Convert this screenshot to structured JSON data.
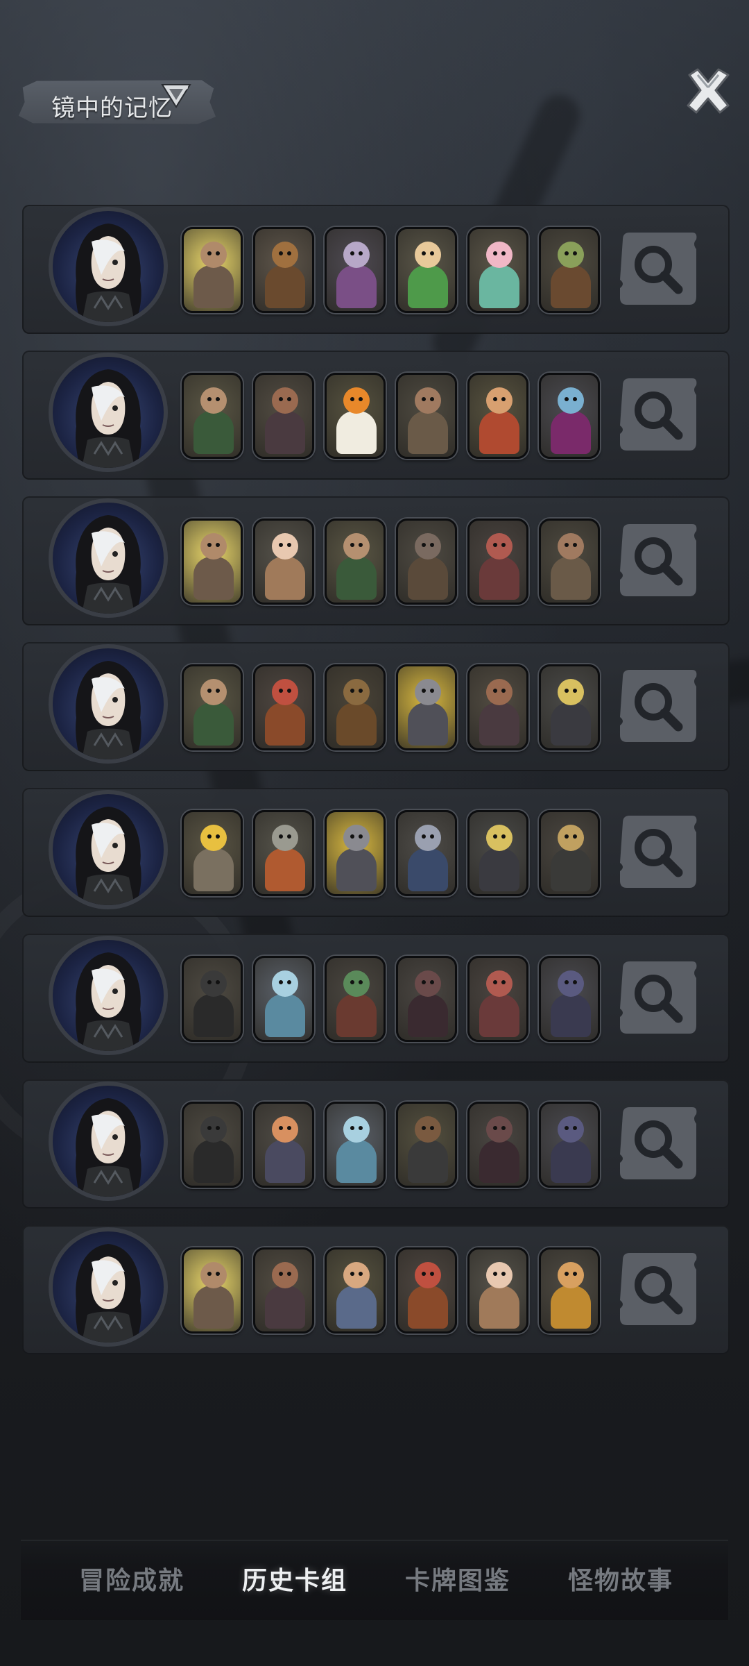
{
  "header": {
    "title": "镜中的记忆",
    "title_icon": "triangle-filter-icon",
    "close_icon": "close-x-icon"
  },
  "deck_rows": [
    {
      "avatar": "hooded-hero-portrait",
      "cards": [
        {
          "name": "armored-knight-card",
          "bg": "#e9d66a",
          "skin": "#b08a6a",
          "cloth": "#6d5a4a"
        },
        {
          "name": "bear-cub-card",
          "bg": "#5e554a",
          "skin": "#a0703f",
          "cloth": "#6a4a2e"
        },
        {
          "name": "mushroom-creature-card",
          "bg": "#4e4a52",
          "skin": "#b7a8c8",
          "cloth": "#7a4f86"
        },
        {
          "name": "leaf-sprite-card",
          "bg": "#5a5648",
          "skin": "#e8c99a",
          "cloth": "#4e9a4a"
        },
        {
          "name": "lotus-fairy-card",
          "bg": "#5a5548",
          "skin": "#f0b7c6",
          "cloth": "#6ab6a0"
        },
        {
          "name": "goblin-witch-card",
          "bg": "#4e4a40",
          "skin": "#8aa05a",
          "cloth": "#6a4a30"
        }
      ],
      "action_icon": "magnifier-icon"
    },
    {
      "avatar": "hooded-hero-portrait",
      "cards": [
        {
          "name": "masked-rogue-card",
          "bg": "#5a5644",
          "skin": "#b59070",
          "cloth": "#3a5a3a"
        },
        {
          "name": "bearded-brute-card",
          "bg": "#524c42",
          "skin": "#9a6a50",
          "cloth": "#4a3a40"
        },
        {
          "name": "pumpkin-head-card",
          "bg": "#56523f",
          "skin": "#e8882a",
          "cloth": "#f0ece0"
        },
        {
          "name": "barbarian-warrior-card",
          "bg": "#4e4a40",
          "skin": "#a07a60",
          "cloth": "#6a5a48"
        },
        {
          "name": "hammer-dwarf-card",
          "bg": "#58533f",
          "skin": "#d8a070",
          "cloth": "#b04a30"
        },
        {
          "name": "dark-elf-card",
          "bg": "#4a4a50",
          "skin": "#7ab0d0",
          "cloth": "#7a2a6a"
        }
      ],
      "action_icon": "magnifier-icon"
    },
    {
      "avatar": "hooded-hero-portrait",
      "cards": [
        {
          "name": "armored-knight-card",
          "bg": "#e9d66a",
          "skin": "#b08a6a",
          "cloth": "#6d5a4a"
        },
        {
          "name": "old-professor-card",
          "bg": "#55524a",
          "skin": "#e8c8b0",
          "cloth": "#a07a5a"
        },
        {
          "name": "masked-rogue-card",
          "bg": "#5a5644",
          "skin": "#b59070",
          "cloth": "#3a5a3a"
        },
        {
          "name": "masked-boar-card",
          "bg": "#4e4a42",
          "skin": "#7a6a60",
          "cloth": "#5a4a3a"
        },
        {
          "name": "red-imp-card",
          "bg": "#4a4440",
          "skin": "#b05a50",
          "cloth": "#6a3a3a"
        },
        {
          "name": "barbarian-warrior-card",
          "bg": "#4e4a40",
          "skin": "#a07a60",
          "cloth": "#6a5a48"
        }
      ],
      "action_icon": "magnifier-icon"
    },
    {
      "avatar": "hooded-hero-portrait",
      "cards": [
        {
          "name": "masked-rogue-card",
          "bg": "#5a5644",
          "skin": "#b59070",
          "cloth": "#3a5a3a"
        },
        {
          "name": "red-ogre-card",
          "bg": "#4e4640",
          "skin": "#c05040",
          "cloth": "#8a4a2a"
        },
        {
          "name": "wooden-golem-card",
          "bg": "#4a4438",
          "skin": "#8a6a40",
          "cloth": "#6a4a2a"
        },
        {
          "name": "lightning-bot-card",
          "bg": "#d8b840",
          "skin": "#8a8a90",
          "cloth": "#505058"
        },
        {
          "name": "bearded-brute-card",
          "bg": "#524c42",
          "skin": "#9a6a50",
          "cloth": "#4a3a40"
        },
        {
          "name": "winged-anubis-card",
          "bg": "#4a4a48",
          "skin": "#d8c060",
          "cloth": "#3a3a40"
        }
      ],
      "action_icon": "magnifier-icon"
    },
    {
      "avatar": "hooded-hero-portrait",
      "cards": [
        {
          "name": "cheese-machine-card",
          "bg": "#5a5544",
          "skin": "#e8c040",
          "cloth": "#7a7060"
        },
        {
          "name": "drill-robot-card",
          "bg": "#55534a",
          "skin": "#9a9a90",
          "cloth": "#b05a30"
        },
        {
          "name": "lightning-bot-card",
          "bg": "#d8b840",
          "skin": "#8a8a90",
          "cloth": "#505058"
        },
        {
          "name": "top-hat-rat-card",
          "bg": "#4e4c48",
          "skin": "#9aa0b0",
          "cloth": "#3a4a6a"
        },
        {
          "name": "winged-anubis-card",
          "bg": "#4a4a48",
          "skin": "#d8c060",
          "cloth": "#3a3a40"
        },
        {
          "name": "puppet-master-card",
          "bg": "#4a4640",
          "skin": "#c0a060",
          "cloth": "#3a3a38"
        }
      ],
      "action_icon": "magnifier-icon"
    },
    {
      "avatar": "hooded-hero-portrait",
      "cards": [
        {
          "name": "shadow-spider-card",
          "bg": "#4e4a42",
          "skin": "#3a3a3a",
          "cloth": "#2a2a2a"
        },
        {
          "name": "frost-fairy-card",
          "bg": "#5a6068",
          "skin": "#a8d0e0",
          "cloth": "#5a8aa0"
        },
        {
          "name": "green-demon-card",
          "bg": "#4a4640",
          "skin": "#5a8a5a",
          "cloth": "#6a3a30"
        },
        {
          "name": "bat-creature-card",
          "bg": "#4a4642",
          "skin": "#6a4a4a",
          "cloth": "#3a2a30"
        },
        {
          "name": "red-imp-card",
          "bg": "#4a4440",
          "skin": "#b05a50",
          "cloth": "#6a3a3a"
        },
        {
          "name": "horned-beast-card",
          "bg": "#4a4a50",
          "skin": "#5a5a80",
          "cloth": "#3a3a50"
        }
      ],
      "action_icon": "magnifier-icon"
    },
    {
      "avatar": "hooded-hero-portrait",
      "cards": [
        {
          "name": "shadow-spider-card",
          "bg": "#4e4a42",
          "skin": "#3a3a3a",
          "cloth": "#2a2a2a"
        },
        {
          "name": "rooster-mage-card",
          "bg": "#4e4a44",
          "skin": "#d89060",
          "cloth": "#4a4a60"
        },
        {
          "name": "frost-fairy-card",
          "bg": "#5a6068",
          "skin": "#a8d0e0",
          "cloth": "#5a8aa0"
        },
        {
          "name": "hedgehog-bandit-card",
          "bg": "#54503f",
          "skin": "#7a5a40",
          "cloth": "#3a3a3a"
        },
        {
          "name": "bat-creature-card",
          "bg": "#4a4642",
          "skin": "#6a4a4a",
          "cloth": "#3a2a30"
        },
        {
          "name": "horned-beast-card",
          "bg": "#4a4a50",
          "skin": "#5a5a80",
          "cloth": "#3a3a50"
        }
      ],
      "action_icon": "magnifier-icon"
    },
    {
      "avatar": "hooded-hero-portrait",
      "cards": [
        {
          "name": "armored-knight-card",
          "bg": "#e9d66a",
          "skin": "#b08a6a",
          "cloth": "#6d5a4a"
        },
        {
          "name": "bearded-brute-card",
          "bg": "#524c42",
          "skin": "#9a6a50",
          "cloth": "#4a3a40"
        },
        {
          "name": "lumberjack-card",
          "bg": "#56523f",
          "skin": "#d8a880",
          "cloth": "#5a6a8a"
        },
        {
          "name": "red-ogre-card",
          "bg": "#4e4640",
          "skin": "#c05040",
          "cloth": "#8a4a2a"
        },
        {
          "name": "old-professor-card",
          "bg": "#55524a",
          "skin": "#e8c8b0",
          "cloth": "#a07a5a"
        },
        {
          "name": "monkey-king-card",
          "bg": "#4e4a42",
          "skin": "#d8a060",
          "cloth": "#c08a30"
        }
      ],
      "action_icon": "magnifier-icon"
    }
  ],
  "tabs": [
    {
      "label": "冒险成就",
      "active": false
    },
    {
      "label": "历史卡组",
      "active": true
    },
    {
      "label": "卡牌图鉴",
      "active": false
    },
    {
      "label": "怪物故事",
      "active": false
    }
  ]
}
